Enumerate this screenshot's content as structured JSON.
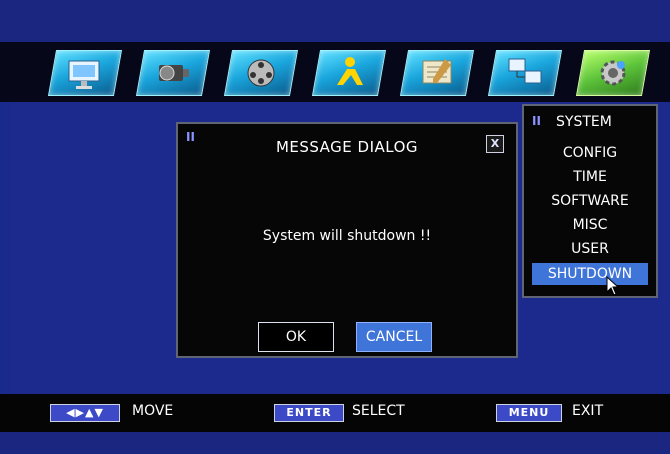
{
  "toolbar": {
    "icons": [
      "monitor-icon",
      "camera-icon",
      "film-reel-icon",
      "person-icon",
      "notebook-icon",
      "network-computer-icon",
      "system-gear-icon"
    ],
    "active": "system-gear-icon"
  },
  "dialog": {
    "grip": "II",
    "title": "MESSAGE DIALOG",
    "close": "X",
    "message": "System will shutdown !!",
    "ok_label": "OK",
    "cancel_label": "CANCEL"
  },
  "system_menu": {
    "grip": "II",
    "title": "SYSTEM",
    "items": [
      "CONFIG",
      "TIME",
      "SOFTWARE",
      "MISC",
      "USER",
      "SHUTDOWN"
    ],
    "selected": "SHUTDOWN"
  },
  "footer": {
    "move_key": "◀▶▲▼",
    "move_label": "MOVE",
    "enter_key": "ENTER",
    "select_label": "SELECT",
    "menu_key": "MENU",
    "exit_label": "EXIT"
  },
  "colors": {
    "background": "#1a2a8c",
    "highlight": "#3f74d8",
    "panel": "#060606"
  }
}
